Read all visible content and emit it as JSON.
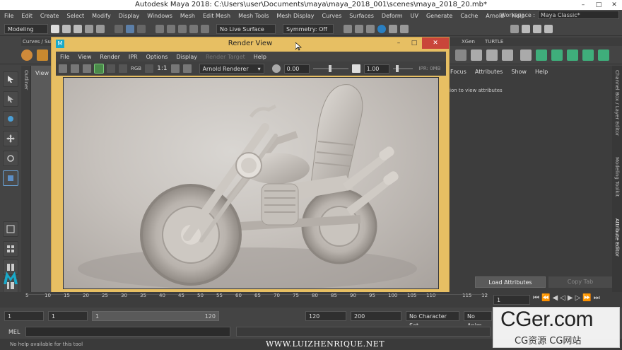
{
  "window": {
    "title": "Autodesk Maya 2018: C:\\Users\\user\\Documents\\maya\\maya_2018_001\\scenes\\maya_2018_20.mb*"
  },
  "menubar": [
    "File",
    "Edit",
    "Create",
    "Select",
    "Modify",
    "Display",
    "Windows",
    "Mesh",
    "Edit Mesh",
    "Mesh Tools",
    "Mesh Display",
    "Curves",
    "Surfaces",
    "Deform",
    "UV",
    "Generate",
    "Cache",
    "Arnold",
    "Help"
  ],
  "workspace": {
    "label": "Workspace :",
    "value": "Maya Classic*"
  },
  "statusline": {
    "mode": "Modeling",
    "live_surface": "No Live Surface",
    "symmetry": "Symmetry: Off"
  },
  "shelftabs": {
    "left": "Curves / Sur",
    "xgen": "XGen",
    "turtle": "TURTLE"
  },
  "viewport": {
    "menu": "View"
  },
  "renderview": {
    "title": "Render View",
    "menu": [
      "File",
      "View",
      "Render",
      "IPR",
      "Options",
      "Display",
      "Render Target",
      "Help"
    ],
    "renderer": "Arnold Renderer",
    "exposure": "0.00",
    "gamma": "1.00",
    "ratio": "1:1",
    "rgb": "RGB",
    "ipr": "IPR: 0MB"
  },
  "attribute": {
    "tabs": [
      "Focus",
      "Attributes",
      "Show",
      "Help"
    ],
    "message": "ion to view attributes",
    "load": "Load Attributes",
    "copy": "Copy Tab"
  },
  "righttabs": [
    "Channel Box / Layer Editor",
    "Modeling Toolkit",
    "Attribute Editor"
  ],
  "outliner": "Outliner",
  "timeline": {
    "ticks": [
      "5",
      "10",
      "15",
      "20",
      "25",
      "30",
      "35",
      "40",
      "45",
      "50",
      "55",
      "60",
      "65",
      "70",
      "75",
      "80",
      "85",
      "90",
      "95",
      "100",
      "105",
      "110",
      "115",
      "12"
    ],
    "current": "1"
  },
  "range": {
    "start": "1",
    "start2": "1",
    "slider_start": "1",
    "slider_end": "120",
    "end": "120",
    "end2": "200",
    "character": "No Character Set",
    "anim": "No Anim"
  },
  "cmdline": {
    "label": "MEL"
  },
  "help": "No help available for this tool",
  "watermark": "WWW.LUIZHENRIQUE.NET",
  "logo": {
    "main": "CGer.com",
    "sub": "CG资源 CG网站"
  }
}
